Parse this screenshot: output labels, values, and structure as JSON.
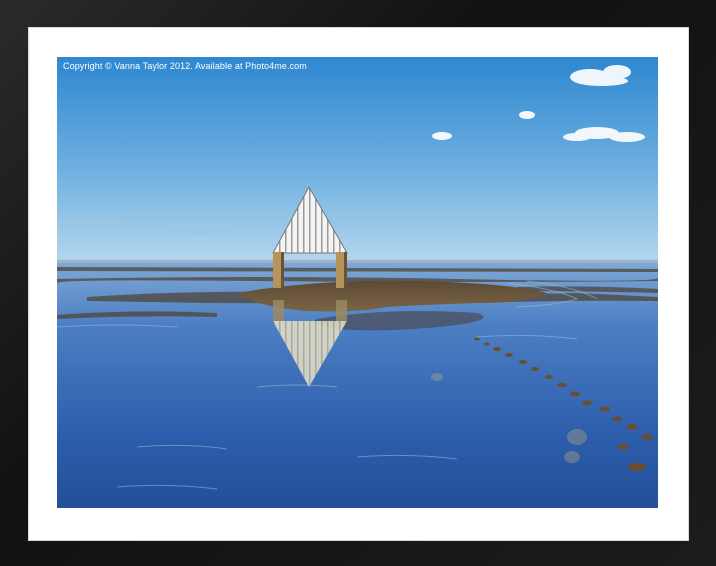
{
  "watermark": {
    "text": "Copyright © Vanna Taylor 2012. Available at Photo4me.com"
  },
  "colors": {
    "frame": "#151515",
    "mat": "#ffffff",
    "sky_top": "#2f86cf",
    "sky_horizon": "#a9cfe9",
    "water": "#2d5fae",
    "sand": "#6e5a3e",
    "shelter_roof": "#f2f2f2",
    "shelter_post": "#b0915a"
  },
  "scene": {
    "subject": "triangular shelter on stilts on a wet beach at low tide",
    "elements": [
      "sky",
      "clouds",
      "horizon",
      "wet-sand",
      "shelter",
      "reflection",
      "footprints"
    ]
  }
}
